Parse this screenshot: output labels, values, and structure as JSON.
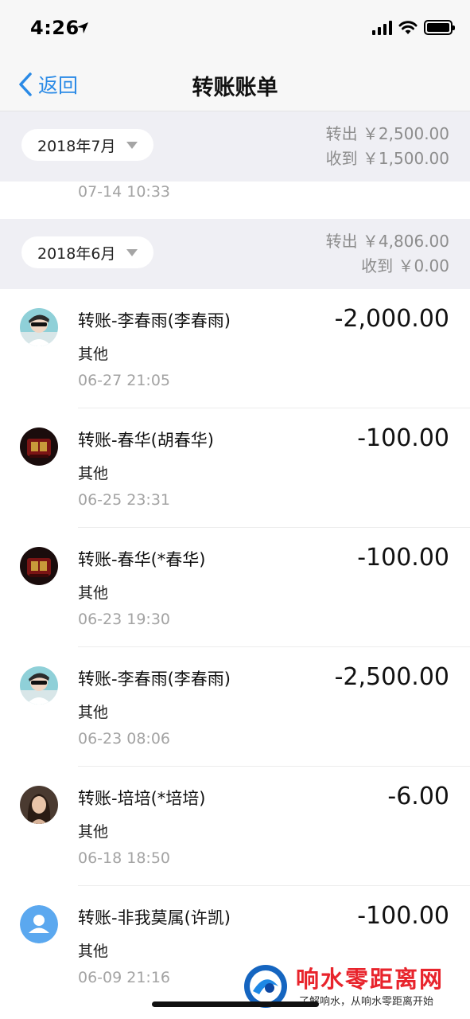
{
  "status_bar": {
    "time": "4:26"
  },
  "nav": {
    "back_label": "返回",
    "title": "转账账单"
  },
  "months": [
    {
      "label": "2018年7月",
      "out": "转出 ￥2,500.00",
      "in": "收到 ￥1,500.00"
    },
    {
      "label": "2018年6月",
      "out": "转出 ￥4,806.00",
      "in": "收到 ￥0.00"
    }
  ],
  "partial_time": "07-14  10:33",
  "transactions": [
    {
      "title": "转账-李春雨(李春雨)",
      "category": "其他",
      "time": "06-27  21:05",
      "amount": "-2,000.00",
      "avatar": "photo-man-icon"
    },
    {
      "title": "转账-春华(胡春华)",
      "category": "其他",
      "time": "06-25  23:31",
      "amount": "-100.00",
      "avatar": "dark-emblem-icon"
    },
    {
      "title": "转账-春华(*春华)",
      "category": "其他",
      "time": "06-23  19:30",
      "amount": "-100.00",
      "avatar": "dark-emblem-icon"
    },
    {
      "title": "转账-李春雨(李春雨)",
      "category": "其他",
      "time": "06-23  08:06",
      "amount": "-2,500.00",
      "avatar": "photo-man-icon"
    },
    {
      "title": "转账-培培(*培培)",
      "category": "其他",
      "time": "06-18  18:50",
      "amount": "-6.00",
      "avatar": "photo-woman-icon"
    },
    {
      "title": "转账-非我莫属(许凯)",
      "category": "其他",
      "time": "06-09  21:16",
      "amount": "-100.00",
      "avatar": "default-user-icon"
    }
  ],
  "watermark": {
    "title": "响水零距离网",
    "subtitle": "了解响水，从响水零距离开始"
  }
}
